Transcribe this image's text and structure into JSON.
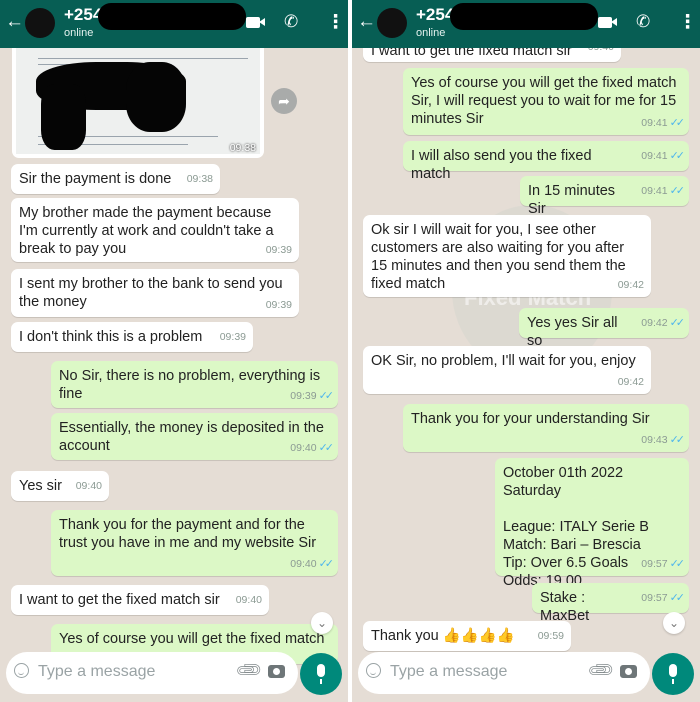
{
  "header": {
    "contact": "+254",
    "status": "online",
    "back_icon": "back-arrow-icon",
    "video_icon": "video-call-icon",
    "call_icon": "phone-icon",
    "menu_icon": "more-vert-icon"
  },
  "colors": {
    "header": "#075e54",
    "chat_bg": "#e5ddd5",
    "incoming": "#ffffff",
    "outgoing": "#dcf8c6",
    "read_tick": "#4fb6ec",
    "mic_button": "#00897b"
  },
  "input": {
    "placeholder": "Type a message",
    "emoji_icon": "emoji-icon",
    "attach_icon": "paperclip-icon",
    "camera_icon": "camera-icon",
    "mic_icon": "mic-icon"
  },
  "left": {
    "image_time": "09:38",
    "messages": [
      {
        "text": "Sir the payment is done",
        "time": "09:38"
      },
      {
        "text": "My brother made the payment because I'm currently at work and couldn't take a break to pay you",
        "time": "09:39"
      },
      {
        "text": "I sent my brother to the bank to send you the money",
        "time": "09:39"
      },
      {
        "text": "I don't think this is a problem",
        "time": "09:39"
      },
      {
        "text": "No Sir, there is no problem, everything is fine",
        "time": "09:39"
      },
      {
        "text": "Essentially, the money is deposited in the account",
        "time": "09:40"
      },
      {
        "text": "Yes sir",
        "time": "09:40"
      },
      {
        "text": "Thank you for the payment and for the trust you have in me and my website Sir",
        "time": "09:40"
      },
      {
        "text": "I want to get the fixed match sir",
        "time": "09:40"
      },
      {
        "text": "Yes of course you will get the fixed match"
      }
    ]
  },
  "right": {
    "messages": [
      {
        "text": "I want to get the fixed match sir",
        "time": "09:40"
      },
      {
        "text": "Yes of course you will get the fixed match Sir, I will request you to wait for me for 15 minutes Sir",
        "time": "09:41"
      },
      {
        "text": "I will also send you the fixed match",
        "time": "09:41"
      },
      {
        "text": "In 15 minutes Sir",
        "time": "09:41"
      },
      {
        "text": "Ok sir I will wait for you, I see other customers are also waiting for you after 15 minutes and then you send them the fixed match",
        "time": "09:42"
      },
      {
        "text": "Yes yes Sir all so",
        "time": "09:42"
      },
      {
        "text": "OK Sir, no problem, I'll wait for you, enjoy",
        "time": "09:42"
      },
      {
        "text": "Thank you for your understanding Sir",
        "time": "09:43"
      },
      {
        "text": "October 01th 2022 Saturday\n\nLeague: ITALY Serie B\nMatch: Bari – Brescia\nTip: Over 6.5 Goals\nOdds: 19.00",
        "time": "09:57"
      },
      {
        "text": "Stake : MaxBet",
        "time": "09:57"
      },
      {
        "text": "Thank you 👍👍👍👍",
        "time": "09:59"
      }
    ]
  }
}
